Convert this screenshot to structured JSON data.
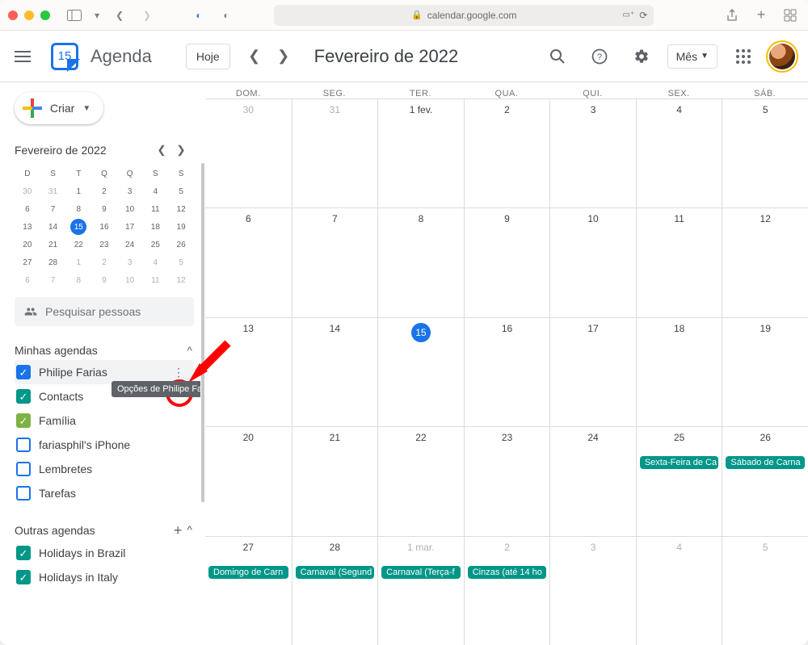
{
  "browser": {
    "url": "calendar.google.com"
  },
  "header": {
    "app_name": "Agenda",
    "today_btn": "Hoje",
    "month_title": "Fevereiro de 2022",
    "view_label": "Mês"
  },
  "sidebar": {
    "create_label": "Criar",
    "minical_title": "Fevereiro de 2022",
    "minical_dow": [
      "D",
      "S",
      "T",
      "Q",
      "Q",
      "S",
      "S"
    ],
    "minical_weeks": [
      [
        {
          "n": 30,
          "dim": true
        },
        {
          "n": 31,
          "dim": true
        },
        {
          "n": 1
        },
        {
          "n": 2
        },
        {
          "n": 3
        },
        {
          "n": 4
        },
        {
          "n": 5
        }
      ],
      [
        {
          "n": 6
        },
        {
          "n": 7
        },
        {
          "n": 8
        },
        {
          "n": 9
        },
        {
          "n": 10
        },
        {
          "n": 11
        },
        {
          "n": 12
        }
      ],
      [
        {
          "n": 13
        },
        {
          "n": 14
        },
        {
          "n": 15,
          "today": true
        },
        {
          "n": 16
        },
        {
          "n": 17
        },
        {
          "n": 18
        },
        {
          "n": 19
        }
      ],
      [
        {
          "n": 20
        },
        {
          "n": 21
        },
        {
          "n": 22
        },
        {
          "n": 23
        },
        {
          "n": 24
        },
        {
          "n": 25
        },
        {
          "n": 26
        }
      ],
      [
        {
          "n": 27
        },
        {
          "n": 28
        },
        {
          "n": 1,
          "dim": true
        },
        {
          "n": 2,
          "dim": true
        },
        {
          "n": 3,
          "dim": true
        },
        {
          "n": 4,
          "dim": true
        },
        {
          "n": 5,
          "dim": true
        }
      ],
      [
        {
          "n": 6,
          "dim": true
        },
        {
          "n": 7,
          "dim": true
        },
        {
          "n": 8,
          "dim": true
        },
        {
          "n": 9,
          "dim": true
        },
        {
          "n": 10,
          "dim": true
        },
        {
          "n": 11,
          "dim": true
        },
        {
          "n": 12,
          "dim": true
        }
      ]
    ],
    "search_placeholder": "Pesquisar pessoas",
    "sections": {
      "mine_title": "Minhas agendas",
      "other_title": "Outras agendas"
    },
    "my_calendars": [
      {
        "label": "Philipe Farias",
        "color": "#1a73e8",
        "checked": true,
        "hover": true
      },
      {
        "label": "Contacts",
        "color": "#009688",
        "checked": true
      },
      {
        "label": "Família",
        "color": "#7cb342",
        "checked": true
      },
      {
        "label": "fariasphil's iPhone",
        "color": "#1a73e8",
        "checked": false
      },
      {
        "label": "Lembretes",
        "color": "#1a73e8",
        "checked": false
      },
      {
        "label": "Tarefas",
        "color": "#1a73e8",
        "checked": false
      }
    ],
    "other_calendars": [
      {
        "label": "Holidays in Brazil",
        "color": "#009688",
        "checked": true
      },
      {
        "label": "Holidays in Italy",
        "color": "#009688",
        "checked": true
      }
    ],
    "tooltip": "Opções de Philipe Farias"
  },
  "calendar": {
    "dow": [
      "DOM.",
      "SEG.",
      "TER.",
      "QUA.",
      "QUI.",
      "SEX.",
      "SÁB."
    ],
    "weeks": [
      [
        {
          "n": "30",
          "dim": true
        },
        {
          "n": "31",
          "dim": true
        },
        {
          "n": "1 fev."
        },
        {
          "n": "2"
        },
        {
          "n": "3"
        },
        {
          "n": "4"
        },
        {
          "n": "5"
        }
      ],
      [
        {
          "n": "6"
        },
        {
          "n": "7"
        },
        {
          "n": "8"
        },
        {
          "n": "9"
        },
        {
          "n": "10"
        },
        {
          "n": "11"
        },
        {
          "n": "12"
        }
      ],
      [
        {
          "n": "13"
        },
        {
          "n": "14"
        },
        {
          "n": "15",
          "today": true
        },
        {
          "n": "16"
        },
        {
          "n": "17"
        },
        {
          "n": "18"
        },
        {
          "n": "19"
        }
      ],
      [
        {
          "n": "20"
        },
        {
          "n": "21"
        },
        {
          "n": "22"
        },
        {
          "n": "23"
        },
        {
          "n": "24"
        },
        {
          "n": "25",
          "ev": "Sexta-Feira de Ca"
        },
        {
          "n": "26",
          "ev": "Sábado de Carna"
        }
      ],
      [
        {
          "n": "27",
          "ev": "Domingo de Carn"
        },
        {
          "n": "28",
          "ev": "Carnaval (Segund"
        },
        {
          "n": "1 mar.",
          "dim": true,
          "ev": "Carnaval (Terça-f"
        },
        {
          "n": "2",
          "dim": true,
          "ev": "Cinzas (até 14 ho"
        },
        {
          "n": "3",
          "dim": true
        },
        {
          "n": "4",
          "dim": true
        },
        {
          "n": "5",
          "dim": true
        }
      ]
    ]
  }
}
